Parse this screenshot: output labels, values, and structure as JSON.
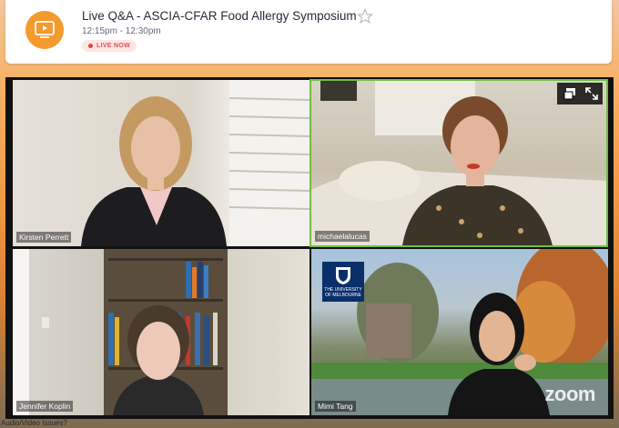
{
  "header": {
    "icon": "video-play-icon",
    "title": "Live Q&A - ASCIA-CFAR Food Allergy Symposium",
    "time": "12:15pm - 12:30pm",
    "live_badge": "LIVE NOW",
    "accent_color": "#f59a2c"
  },
  "video": {
    "participants": [
      {
        "name": "Kirsten Perrett",
        "active": false
      },
      {
        "name": "michaelalucas",
        "active": true
      },
      {
        "name": "Jennifer Koplin",
        "active": false
      },
      {
        "name": "Mimi Tang",
        "active": false
      }
    ],
    "logo_text": "THE UNIVERSITY OF MELBOURNE",
    "watermark": "zoom",
    "active_speaker_color": "#6fbf44"
  },
  "footer": {
    "help_link": "Audio/Video Issues?"
  }
}
